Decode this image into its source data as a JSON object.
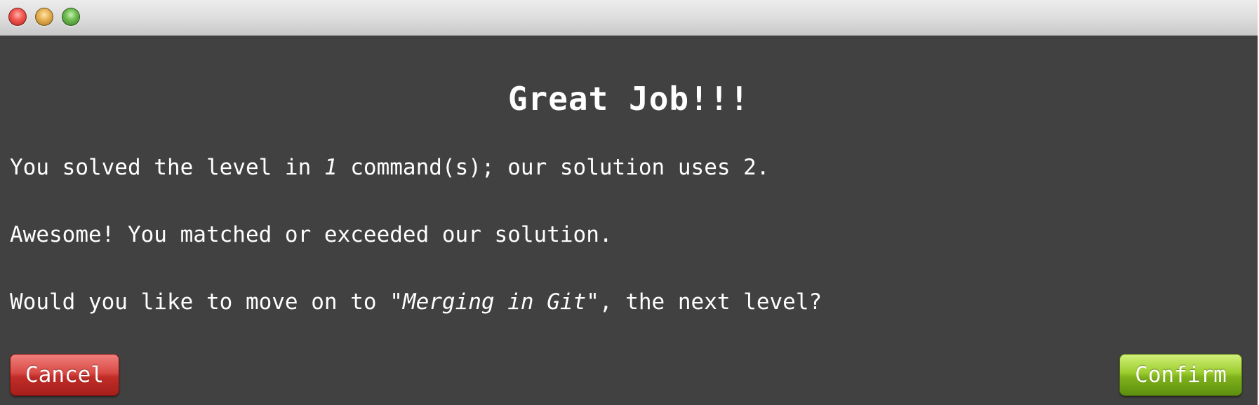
{
  "dialog": {
    "heading": "Great Job!!!",
    "line1": {
      "before": "You solved the level in ",
      "count": "1",
      "after": " command(s); our solution uses 2."
    },
    "line2": "Awesome! You matched or exceeded our solution.",
    "line3": {
      "before": "Would you like to move on to \"",
      "level_name": "Merging in Git",
      "after": "\", the next level?"
    },
    "cancel_label": "Cancel",
    "confirm_label": "Confirm"
  },
  "colors": {
    "background": "#414141",
    "text": "#ffffff",
    "cancel": "#c12d28",
    "confirm": "#7fb21b",
    "close_light": "#f25a52",
    "minimize_light": "#e8b356",
    "maximize_light": "#6fbe52"
  }
}
